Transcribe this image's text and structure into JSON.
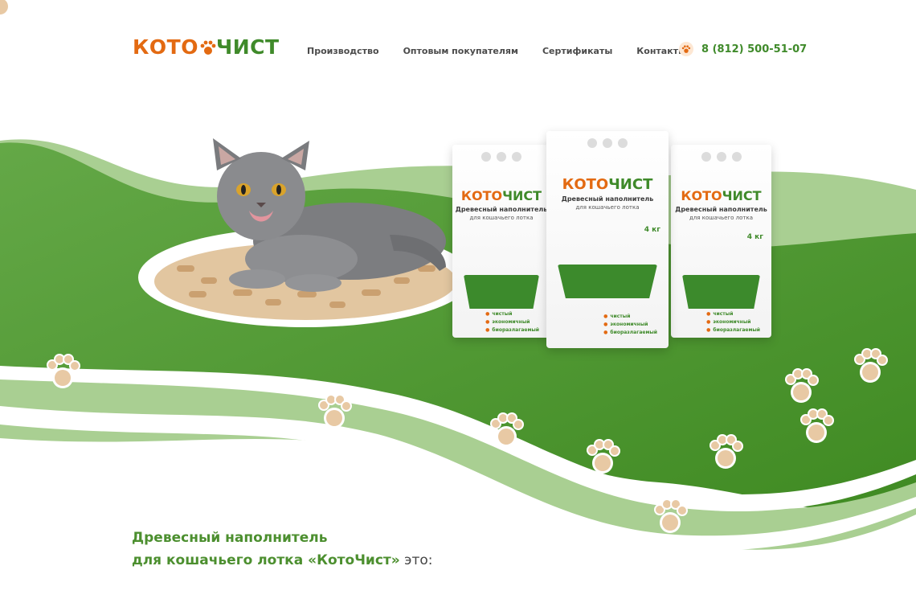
{
  "header": {
    "logo": {
      "part1": "КОТО",
      "part2": "ЧИСТ"
    },
    "nav": [
      {
        "label": "Производство"
      },
      {
        "label": "Оптовым покупателям"
      },
      {
        "label": "Сертификаты"
      },
      {
        "label": "Контакты"
      }
    ],
    "phone": "8 (812) 500-51-07"
  },
  "product": {
    "brand_part1": "КОТО",
    "brand_part2": "ЧИСТ",
    "title": "Древесный наполнитель",
    "subtitle": "для кошачьего лотка",
    "weight": "4 кг",
    "features": [
      "чистый",
      "экономичный",
      "биоразлагаемый"
    ]
  },
  "hero": {
    "heading_line1": "Древесный наполнитель",
    "heading_line2": "для кошачьего лотка «КотоЧист»",
    "heading_tail": " это:"
  },
  "colors": {
    "brand_orange": "#e36a12",
    "brand_green": "#3f8a2a",
    "wave_dark": "#4f9a34",
    "wave_light": "#a9cf92"
  }
}
